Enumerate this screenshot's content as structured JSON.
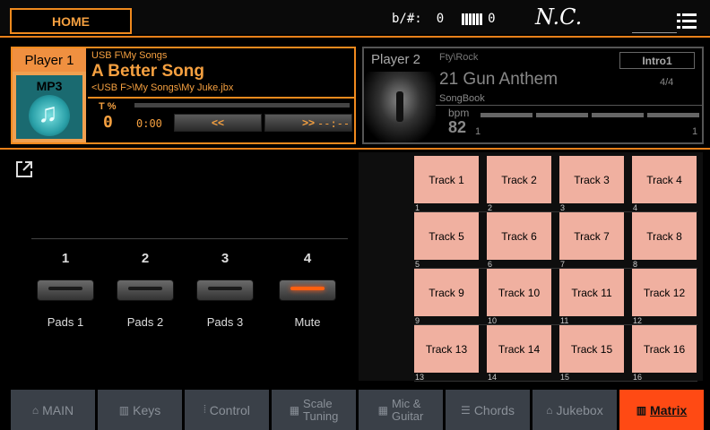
{
  "topbar": {
    "home_label": "HOME",
    "transpose_label": "b/#:",
    "transpose_value": "0",
    "octave_value": "0",
    "chord": "N.C."
  },
  "player1": {
    "label": "Player 1",
    "media_type": "MP3",
    "path": "USB F\\My Songs",
    "title": "A Better Song",
    "subpath": "<USB F>\\My Songs\\My Juke.jbx",
    "tempo_label": "T %",
    "tempo_value": "0",
    "time": "0:00",
    "rewind_label": "<<",
    "forward_label": ">>",
    "remaining": "--:--",
    "progress": 0
  },
  "player2": {
    "label": "Player 2",
    "path": "Fty\\Rock",
    "section": "Intro1",
    "title": "21 Gun Anthem",
    "meter": "4/4",
    "source": "SongBook",
    "bpm_label": "bpm",
    "bpm_value": "82",
    "beat_start": "1",
    "beat_end": "1"
  },
  "pads": [
    {
      "num": "1",
      "label": "Pads 1",
      "active": false
    },
    {
      "num": "2",
      "label": "Pads 2",
      "active": false
    },
    {
      "num": "3",
      "label": "Pads 3",
      "active": false
    },
    {
      "num": "4",
      "label": "Mute",
      "active": true
    }
  ],
  "matrix": {
    "tracks": [
      "Track 1",
      "Track 2",
      "Track 3",
      "Track 4",
      "Track 5",
      "Track 6",
      "Track 7",
      "Track 8",
      "Track 9",
      "Track 10",
      "Track 11",
      "Track 12",
      "Track 13",
      "Track 14",
      "Track 15",
      "Track 16"
    ],
    "numbers": [
      "1",
      "2",
      "3",
      "4",
      "5",
      "6",
      "7",
      "8",
      "9",
      "10",
      "11",
      "12",
      "13",
      "14",
      "15",
      "16"
    ]
  },
  "tabs": [
    {
      "label": "MAIN",
      "icon": "home-icon"
    },
    {
      "label": "Keys",
      "icon": "keys-icon"
    },
    {
      "label": "Control",
      "icon": "control-icon"
    },
    {
      "label_line1": "Scale",
      "label_line2": "Tuning",
      "icon": "scale-icon"
    },
    {
      "label_line1": "Mic &",
      "label_line2": "Guitar",
      "icon": "mic-icon"
    },
    {
      "label": "Chords",
      "icon": "chords-icon"
    },
    {
      "label": "Jukebox",
      "icon": "jukebox-icon"
    },
    {
      "label": "Matrix",
      "icon": "matrix-icon",
      "active": true
    }
  ],
  "colors": {
    "accent": "#f08a1e",
    "track_cell": "#f0b0a0",
    "active_tab": "#ff4a14"
  }
}
